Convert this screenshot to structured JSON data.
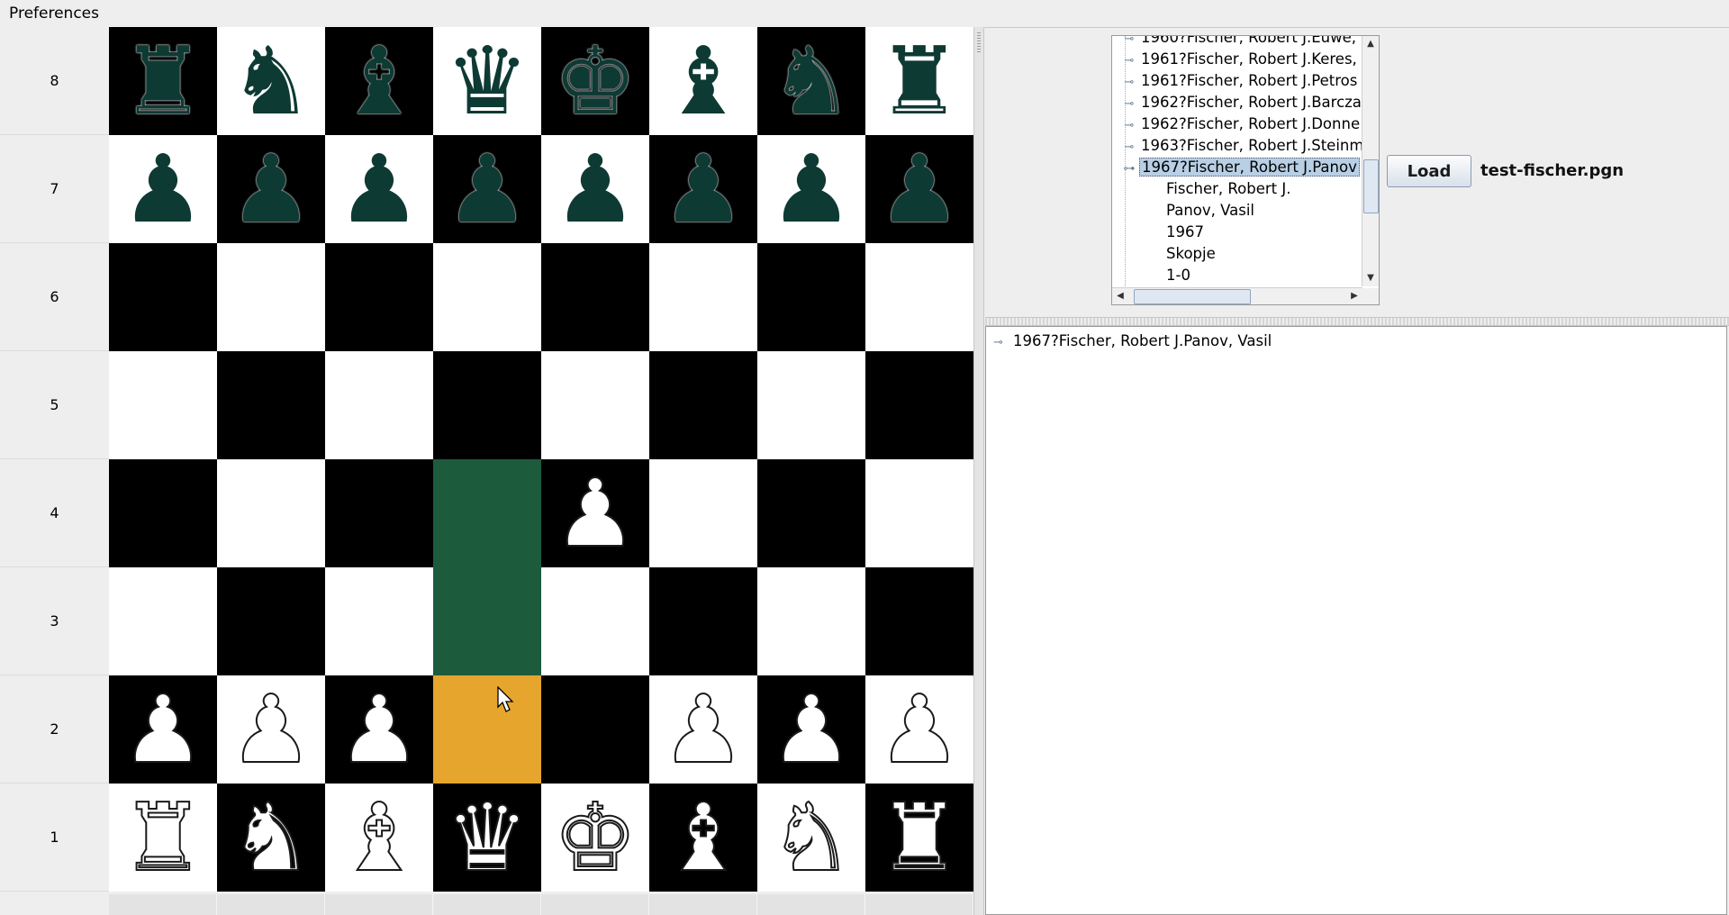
{
  "menu": {
    "preferences": "Preferences"
  },
  "ranks": [
    "8",
    "7",
    "6",
    "5",
    "4",
    "3",
    "2",
    "1"
  ],
  "board": {
    "colors": {
      "light": "#ffffff",
      "dark": "#000000",
      "path_highlight": "#1c5c3c",
      "selected_highlight": "#e6a52c"
    },
    "squares": [
      [
        "r",
        "n",
        "b",
        "q",
        "k",
        "b",
        "n",
        "r"
      ],
      [
        "p",
        "p",
        "p",
        "p",
        "p",
        "p",
        "p",
        "p"
      ],
      [
        "",
        "",
        "",
        "",
        "",
        "",
        "",
        ""
      ],
      [
        "",
        "",
        "",
        "",
        "",
        "",
        "",
        ""
      ],
      [
        "",
        "",
        "",
        "",
        "P",
        "",
        "",
        ""
      ],
      [
        "",
        "",
        "",
        "",
        "",
        "",
        "",
        ""
      ],
      [
        "P",
        "P",
        "P",
        "",
        "",
        "P",
        "P",
        "P"
      ],
      [
        "R",
        "N",
        "B",
        "Q",
        "K",
        "B",
        "N",
        "R"
      ]
    ],
    "highlights": {
      "path": [
        "d4",
        "d3"
      ],
      "selected": "d2"
    }
  },
  "tree": {
    "rows": [
      {
        "text": "1960?Fischer, Robert J.Euwe,",
        "kind": "parent",
        "selected": false
      },
      {
        "text": "1961?Fischer, Robert J.Keres,",
        "kind": "parent",
        "selected": false
      },
      {
        "text": "1961?Fischer, Robert J.Petros",
        "kind": "parent",
        "selected": false
      },
      {
        "text": "1962?Fischer, Robert J.Barcza",
        "kind": "parent",
        "selected": false
      },
      {
        "text": "1962?Fischer, Robert J.Donne",
        "kind": "parent",
        "selected": false
      },
      {
        "text": "1963?Fischer, Robert J.Steinm",
        "kind": "parent",
        "selected": false
      },
      {
        "text": "1967?Fischer, Robert J.Panov",
        "kind": "parent",
        "selected": true
      },
      {
        "text": "Fischer, Robert J.",
        "kind": "leaf",
        "selected": false
      },
      {
        "text": "Panov, Vasil",
        "kind": "leaf",
        "selected": false
      },
      {
        "text": "1967",
        "kind": "leaf",
        "selected": false
      },
      {
        "text": "Skopje",
        "kind": "leaf",
        "selected": false
      },
      {
        "text": "1-0",
        "kind": "leaf",
        "selected": false
      }
    ]
  },
  "load_button": "Load",
  "file_name": "test-fischer.pgn",
  "moves_tree": {
    "root": "1967?Fischer, Robert J.Panov, Vasil"
  },
  "icons": {
    "tree_handle": "key-handle-icon",
    "scroll_up": "arrow-up-icon",
    "scroll_down": "arrow-down-icon",
    "scroll_left": "arrow-left-icon",
    "scroll_right": "arrow-right-icon",
    "cursor": "mouse-pointer-icon"
  }
}
